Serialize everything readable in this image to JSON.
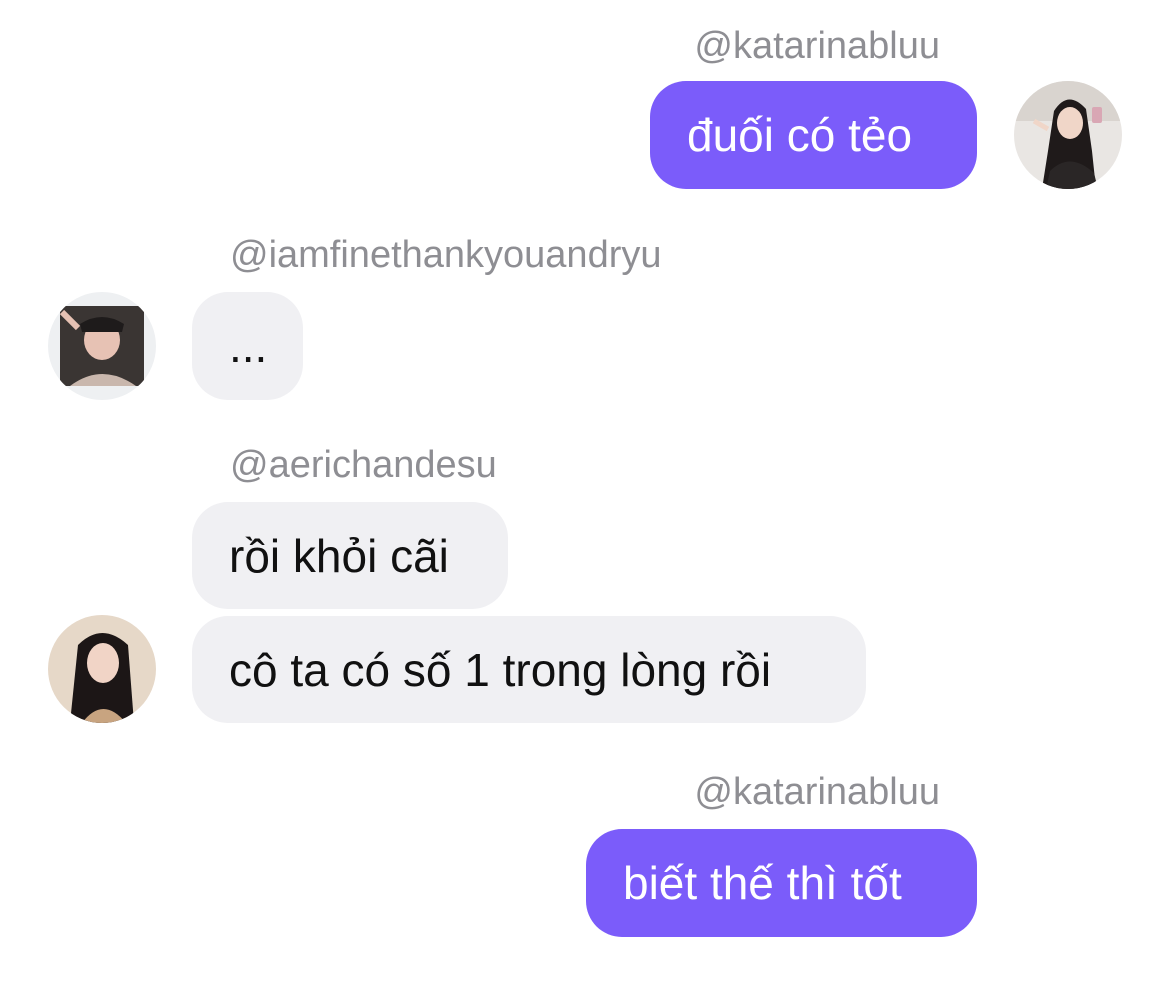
{
  "messages": [
    {
      "sender": "@katarinabluu",
      "text": "đuối có tẻo",
      "direction": "outgoing"
    },
    {
      "sender": "@iamfinethankyouandryu",
      "text": "...",
      "direction": "incoming"
    },
    {
      "sender": "@aerichandesu",
      "text": "rồi khỏi cãi",
      "direction": "incoming"
    },
    {
      "sender": "@aerichandesu",
      "text": "cô ta có số 1 trong lòng rồi",
      "direction": "incoming"
    },
    {
      "sender": "@katarinabluu",
      "text": "biết thế thì tốt",
      "direction": "outgoing"
    }
  ],
  "colors": {
    "outgoing_bubble": "#7b5cfa",
    "incoming_bubble": "#f0f0f3",
    "username": "#8e8e93"
  },
  "icons": [
    "avatar-katarinabluu",
    "avatar-iamfinethankyouandryu",
    "avatar-aerichandesu"
  ]
}
